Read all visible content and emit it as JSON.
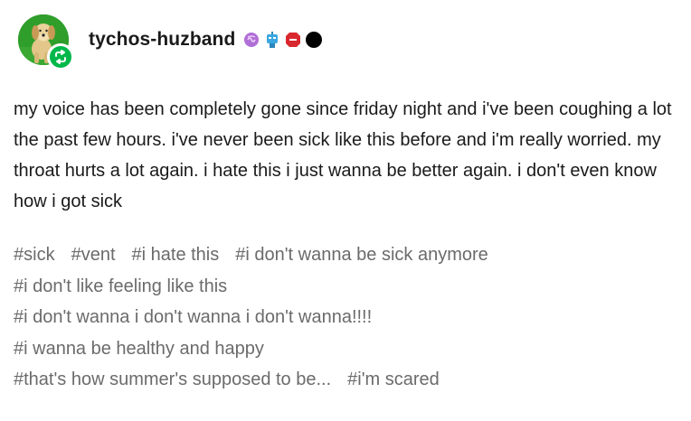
{
  "post": {
    "username": "tychos-huzband",
    "body": "my voice has been completely gone since friday night and i've been coughing a lot the past few hours. i've never been sick like this before and i'm really worried. my throat hurts a lot again. i hate this i just wanna be better again. i don't even know how i got sick",
    "tag_lines": [
      [
        "#sick",
        "#vent",
        "#i hate this",
        "#i don't wanna be sick anymore"
      ],
      [
        "#i don't like feeling like this"
      ],
      [
        "#i don't wanna i don't wanna i don't wanna!!!!"
      ],
      [
        "#i wanna be healthy and happy"
      ],
      [
        "#that's how summer's supposed to be...",
        "#i'm scared"
      ]
    ]
  },
  "icons": {
    "avatar": "golden-retriever-dog-avatar",
    "reblog_badge": "reblog-icon",
    "badges": [
      "purple-brain-badge",
      "blue-robot-badge",
      "red-stop-sign-badge",
      "black-circle-badge"
    ]
  },
  "colors": {
    "avatar_bg": "#2f9e2b",
    "reblog_badge": "#00b84a",
    "tag_text": "#6b6b6b",
    "body_text": "#1a1a1a"
  }
}
